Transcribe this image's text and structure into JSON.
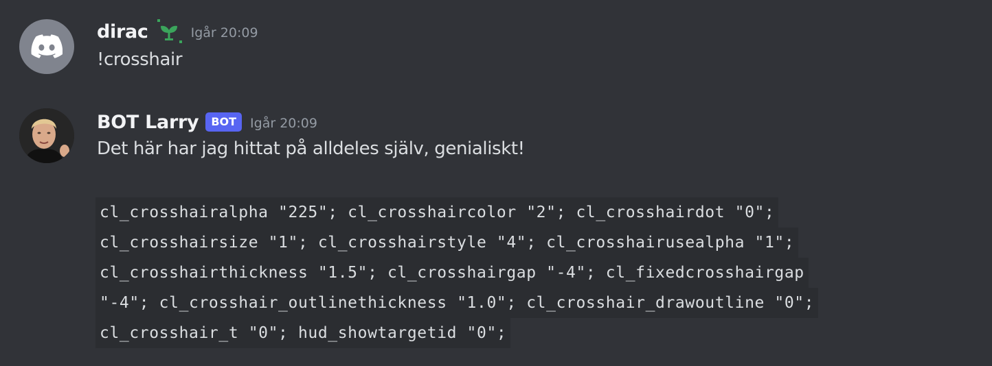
{
  "messages": [
    {
      "username": "dirac",
      "badge_icon": "sprout-icon",
      "timestamp": "Igår 20:09",
      "text": "!crosshair",
      "avatar": "discord-logo-icon"
    },
    {
      "username": "BOT Larry",
      "badge": "BOT",
      "timestamp": "Igår 20:09",
      "text": "Det här har jag hittat på alldeles själv, genialiskt!",
      "avatar": "user-photo",
      "code_lines": [
        "cl_crosshairalpha \"225\"; cl_crosshaircolor \"2\"; cl_crosshairdot \"0\";",
        "cl_crosshairsize \"1\"; cl_crosshairstyle \"4\"; cl_crosshairusealpha \"1\";",
        "cl_crosshairthickness \"1.5\"; cl_crosshairgap \"-4\"; cl_fixedcrosshairgap",
        "\"-4\"; cl_crosshair_outlinethickness \"1.0\"; cl_crosshair_drawoutline \"0\";",
        "cl_crosshair_t \"0\"; hud_showtargetid \"0\";"
      ]
    }
  ],
  "colors": {
    "background": "#313338",
    "bot_badge": "#5865f2",
    "sprout": "#3ba55c",
    "code_background": "#2b2d31"
  }
}
